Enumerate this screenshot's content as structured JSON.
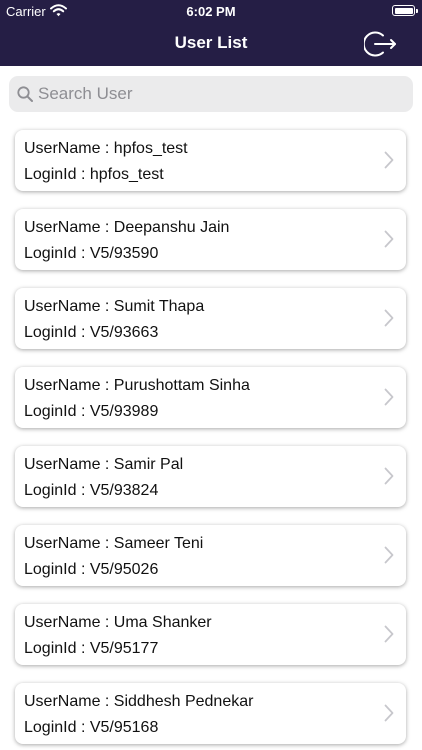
{
  "status_bar": {
    "carrier": "Carrier",
    "time": "6:02 PM"
  },
  "header": {
    "title": "User List"
  },
  "search": {
    "placeholder": "Search User",
    "value": ""
  },
  "users": [
    {
      "username_line": "UserName : hpfos_test",
      "loginid_line": "LoginId : hpfos_test"
    },
    {
      "username_line": "UserName : Deepanshu Jain",
      "loginid_line": "LoginId : V5/93590"
    },
    {
      "username_line": "UserName : Sumit Thapa",
      "loginid_line": "LoginId : V5/93663"
    },
    {
      "username_line": "UserName : Purushottam Sinha",
      "loginid_line": "LoginId : V5/93989"
    },
    {
      "username_line": "UserName : Samir Pal",
      "loginid_line": "LoginId : V5/93824"
    },
    {
      "username_line": "UserName : Sameer Teni",
      "loginid_line": "LoginId : V5/95026"
    },
    {
      "username_line": "UserName : Uma Shanker",
      "loginid_line": "LoginId : V5/95177"
    },
    {
      "username_line": "UserName : Siddhesh Pednekar",
      "loginid_line": "LoginId : V5/95168"
    }
  ],
  "colors": {
    "header_bg": "#251e45",
    "search_bg": "#ebebec",
    "chevron": "#c7c7cc"
  },
  "icons": {
    "signal": "wifi-icon",
    "battery": "battery-icon",
    "logout": "logout-icon",
    "search": "search-icon",
    "row": "chevron-right-icon"
  }
}
